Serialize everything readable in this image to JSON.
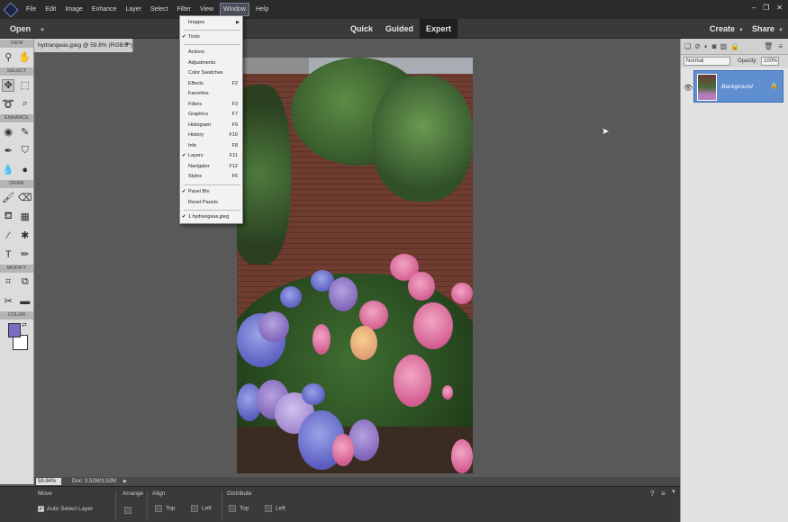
{
  "menubar": {
    "items": [
      "File",
      "Edit",
      "Image",
      "Enhance",
      "Layer",
      "Select",
      "Filter",
      "View",
      "Window",
      "Help"
    ],
    "active": "Window"
  },
  "modebar": {
    "open_label": "Open",
    "modes": [
      "Quick",
      "Guided",
      "Expert"
    ],
    "selected_mode": "Expert",
    "create_label": "Create",
    "share_label": "Share"
  },
  "toolbox": {
    "sections": {
      "view": "VIEW",
      "select": "SELECT",
      "enhance": "ENHANCE",
      "draw": "DRAW",
      "modify": "MODIFY",
      "color": "COLOR"
    },
    "foreground_color": "#7a6cc1",
    "background_color": "#ffffff"
  },
  "document": {
    "tab_title": "hydrangeas.jpeg @ 59.8% (RGB/8*)",
    "close": "×"
  },
  "status": {
    "zoom": "59.84%",
    "doc_size": "Doc: 3.52M/3.52M"
  },
  "options": {
    "move_label": "Move",
    "auto_select_label": "Auto Select Layer",
    "arrange_label": "Arrange",
    "align_label": "Align",
    "align_top": "Top",
    "align_left": "Left",
    "distribute_label": "Distribute",
    "distribute_top": "Top",
    "distribute_left": "Left"
  },
  "layers_panel": {
    "blend_mode": "Normal",
    "opacity_label": "Opacity:",
    "opacity_value": "100%",
    "layer_name": "Background"
  },
  "window_menu": {
    "items": [
      {
        "label": "Images",
        "check": "",
        "shortcut": "",
        "submenu": "▶"
      },
      {
        "label": "Tools",
        "check": "✔",
        "shortcut": ""
      },
      {
        "label": "Actions",
        "check": "",
        "shortcut": ""
      },
      {
        "label": "Adjustments",
        "check": "",
        "shortcut": ""
      },
      {
        "label": "Color Swatches",
        "check": "",
        "shortcut": ""
      },
      {
        "label": "Effects",
        "check": "",
        "shortcut": "F2"
      },
      {
        "label": "Favorites",
        "check": "",
        "shortcut": ""
      },
      {
        "label": "Filters",
        "check": "",
        "shortcut": "F3"
      },
      {
        "label": "Graphics",
        "check": "",
        "shortcut": "F7"
      },
      {
        "label": "Histogram",
        "check": "",
        "shortcut": "F9"
      },
      {
        "label": "History",
        "check": "",
        "shortcut": "F10"
      },
      {
        "label": "Info",
        "check": "",
        "shortcut": "F8"
      },
      {
        "label": "Layers",
        "check": "✔",
        "shortcut": "F11"
      },
      {
        "label": "Navigator",
        "check": "",
        "shortcut": "F12"
      },
      {
        "label": "Styles",
        "check": "",
        "shortcut": "F6"
      },
      {
        "label": "Panel Bin",
        "check": "✔",
        "shortcut": ""
      },
      {
        "label": "Reset Panels",
        "check": "",
        "shortcut": ""
      },
      {
        "label": "1 hydrangeas.jpeg",
        "check": "✔",
        "shortcut": ""
      }
    ]
  }
}
